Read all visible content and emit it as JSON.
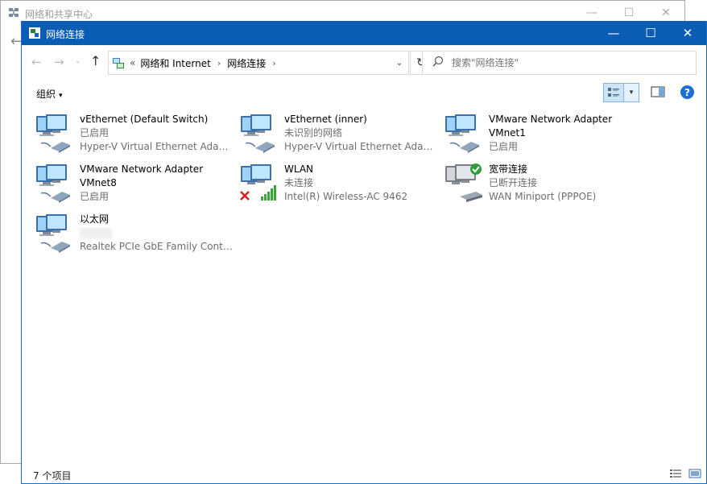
{
  "background_window": {
    "title": "网络和共享中心",
    "back_glyph": "←"
  },
  "window": {
    "title": "网络连接",
    "controls": {
      "minimize": "—",
      "maximize": "☐",
      "close": "✕"
    }
  },
  "nav": {
    "back": "←",
    "forward": "→",
    "history": "⌄",
    "up": "↑",
    "refresh": "↻"
  },
  "address": {
    "overflow": "«",
    "crumbs": [
      "网络和 Internet",
      "网络连接"
    ],
    "separator": "›",
    "dropdown": "⌄"
  },
  "search": {
    "placeholder": "搜索\"网络连接\"",
    "value": ""
  },
  "toolbar": {
    "organize_label": "组织",
    "caret": "▾",
    "help": "?"
  },
  "items": [
    {
      "name": "vEthernet (Default Switch)",
      "status": "已启用",
      "device": "Hyper-V Virtual Ethernet Adap...",
      "kind": "ethernet"
    },
    {
      "name": "vEthernet (inner)",
      "status": "未识别的网络",
      "device": "Hyper-V Virtual Ethernet Adap...",
      "kind": "ethernet"
    },
    {
      "name": "VMware Network Adapter",
      "name2": "VMnet1",
      "status": "已启用",
      "device": "",
      "kind": "ethernet"
    },
    {
      "name": "VMware Network Adapter",
      "name2": "VMnet8",
      "status": "已启用",
      "device": "",
      "kind": "ethernet"
    },
    {
      "name": "WLAN",
      "status": "未连接",
      "device": "Intel(R) Wireless-AC 9462",
      "kind": "wifi"
    },
    {
      "name": "宽带连接",
      "status": "已断开连接",
      "device": "WAN Miniport (PPPOE)",
      "kind": "broadband"
    },
    {
      "name": "以太网",
      "status": "",
      "device": "Realtek PCIe GbE Family Contr...",
      "kind": "ethernet"
    }
  ],
  "statusbar": {
    "count": "7 个项目"
  },
  "colors": {
    "titlebar": "#0b5cb3",
    "select_bg": "#cce4f7"
  }
}
